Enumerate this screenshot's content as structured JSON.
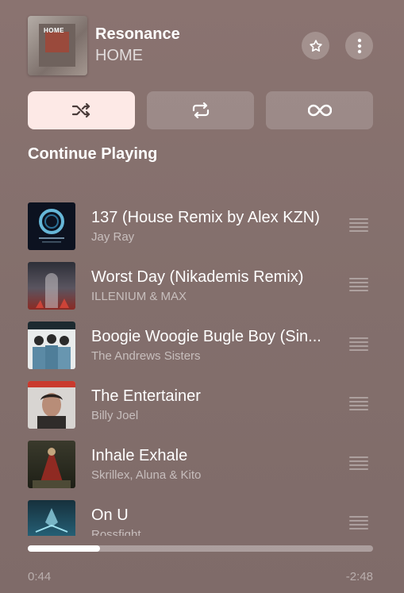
{
  "now_playing": {
    "title": "Resonance",
    "artist": "HOME",
    "artwork_text": "HOME"
  },
  "modes": [
    {
      "name": "shuffle",
      "icon": "shuffle-icon",
      "active": true
    },
    {
      "name": "repeat",
      "icon": "repeat-icon",
      "active": false
    },
    {
      "name": "infinity",
      "icon": "infinity-icon",
      "active": false
    }
  ],
  "section_title": "Continue Playing",
  "queue": [
    {
      "title": "137 (House Remix by Alex KZN)",
      "artist": "Jay Ray"
    },
    {
      "title": "Worst Day (Nikademis Remix)",
      "artist": "ILLENIUM & MAX"
    },
    {
      "title": "Boogie Woogie Bugle Boy (Sin...",
      "artist": "The Andrews Sisters"
    },
    {
      "title": "The Entertainer",
      "artist": "Billy Joel"
    },
    {
      "title": "Inhale Exhale",
      "artist": "Skrillex, Aluna & Kito"
    },
    {
      "title": "On U",
      "artist": "Rossfight"
    }
  ],
  "progress": {
    "fraction": 0.21,
    "elapsed": "0:44",
    "remaining": "-2:48"
  },
  "colors": {
    "active_mode_bg": "#fde9e6"
  }
}
